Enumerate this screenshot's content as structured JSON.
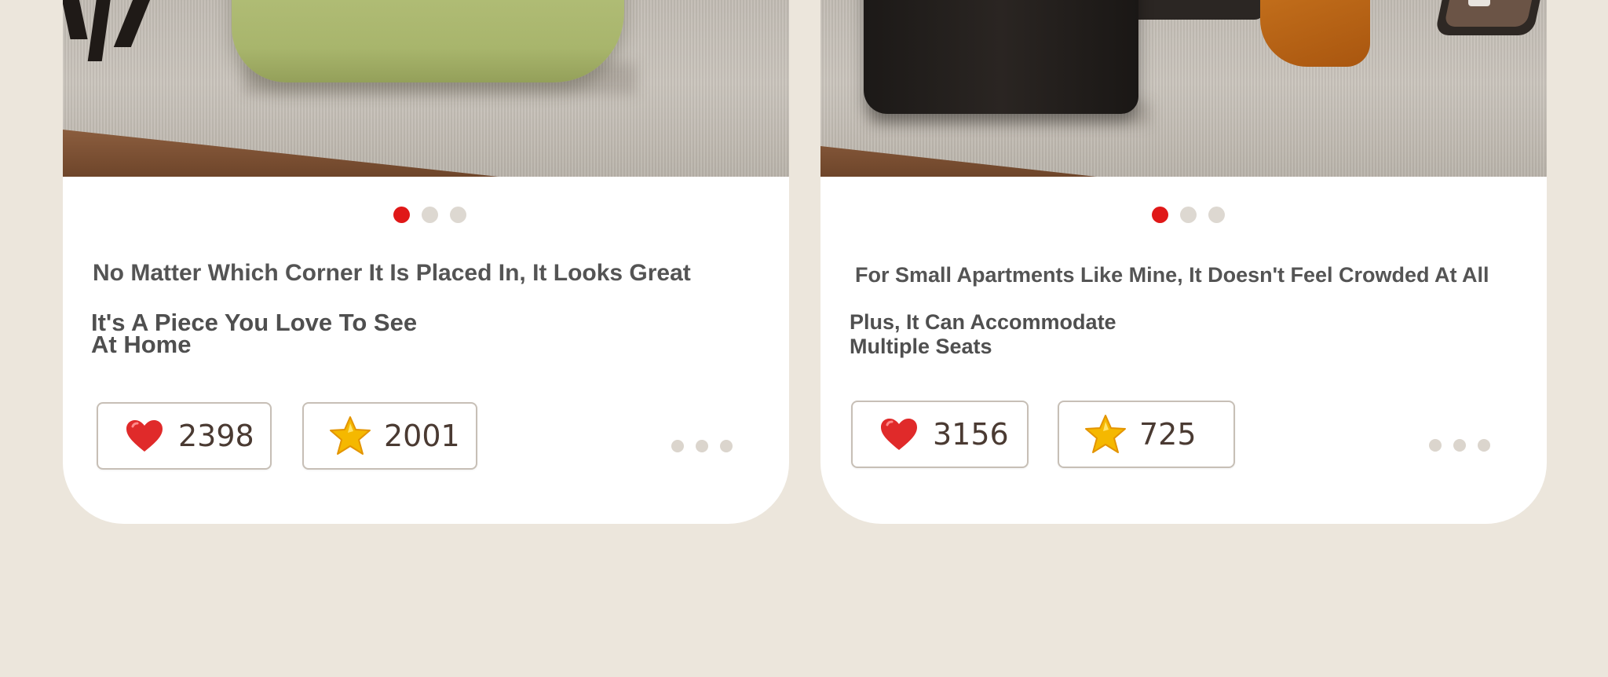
{
  "cards": [
    {
      "image_description": "",
      "pager": {
        "count": 3,
        "active": 0
      },
      "title": "No Matter Which Corner It Is Placed In, It Looks Great",
      "subtitle_lines": [
        "It's A Piece You Love To See",
        "At Home"
      ],
      "likes": "2398",
      "favorites": "2001",
      "like_icon": "heart-icon",
      "favorite_icon": "star-icon"
    },
    {
      "image_description": "",
      "pager": {
        "count": 3,
        "active": 0
      },
      "title": "For Small Apartments Like Mine, It Doesn't Feel Crowded At All",
      "subtitle_lines": [
        "Plus, It Can Accommodate",
        "Multiple Seats"
      ],
      "likes": "3156",
      "favorites": "725",
      "like_icon": "heart-icon",
      "favorite_icon": "star-icon"
    }
  ],
  "colors": {
    "page_background": "#ece6dc",
    "card_background": "#ffffff",
    "active_dot": "#e01818",
    "inactive_dot": "#ddd8d1",
    "heart": "#e02a2a",
    "star": "#f5b800"
  }
}
